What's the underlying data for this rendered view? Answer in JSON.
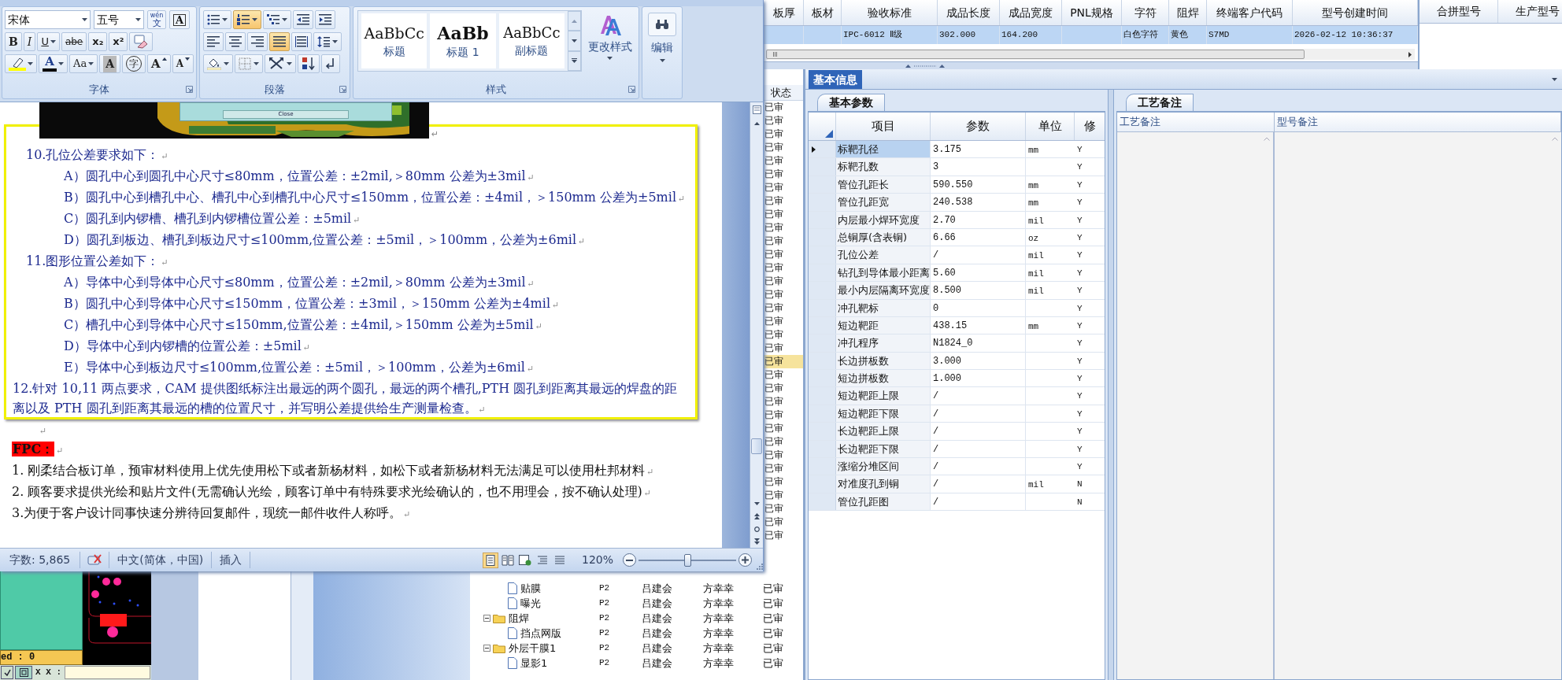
{
  "word": {
    "ribbon": {
      "font_name": "宋体",
      "font_size": "五号",
      "phonetic": {
        "ruby": "wén",
        "char": "文"
      },
      "char_border": "A",
      "font_tools": [
        {
          "kind": "bold",
          "label": "B"
        },
        {
          "kind": "italic",
          "label": "I"
        },
        {
          "kind": "underline",
          "label": "U",
          "dropdown": true
        },
        {
          "kind": "strike",
          "label": "abe"
        },
        {
          "kind": "subscript",
          "label": "x₂"
        },
        {
          "kind": "superscript",
          "label": "x²"
        },
        {
          "kind": "clear"
        }
      ],
      "font_tools_2": [
        {
          "kind": "highlight",
          "dropdown": true
        },
        {
          "kind": "color",
          "label": "A",
          "dropdown": true
        },
        {
          "kind": "case",
          "label": "Aa",
          "dropdown": true
        },
        {
          "kind": "shade",
          "label": "A"
        },
        {
          "kind": "enclose",
          "label": "字"
        },
        {
          "kind": "grow",
          "label": "A"
        },
        {
          "kind": "shrink",
          "label": "A"
        }
      ],
      "para_tools": [
        [
          {
            "kind": "bullets",
            "dropdown": true,
            "selected": false
          },
          {
            "kind": "numbering",
            "dropdown": true,
            "selected": true
          },
          {
            "kind": "multilevel",
            "dropdown": true,
            "selected": false
          },
          {
            "kind": "outdent",
            "selected": false
          },
          {
            "kind": "indent",
            "selected": false
          }
        ],
        [
          {
            "kind": "align-left",
            "selected": false
          },
          {
            "kind": "align-center",
            "selected": false
          },
          {
            "kind": "align-right",
            "selected": false
          },
          {
            "kind": "justify",
            "selected": true
          },
          {
            "kind": "distribute",
            "selected": false
          },
          {
            "kind": "line-spacing",
            "dropdown": true,
            "selected": false
          }
        ],
        [
          {
            "kind": "shading",
            "dropdown": true,
            "selected": false
          },
          {
            "kind": "borders",
            "dropdown": true,
            "selected": false
          },
          {
            "kind": "direction",
            "dropdown": true,
            "selected": false
          },
          {
            "kind": "sort",
            "selected": false
          },
          {
            "kind": "marks",
            "selected": false
          }
        ]
      ],
      "styles": [
        {
          "sample": "AaBbCc",
          "name": "标题",
          "kind": "title"
        },
        {
          "sample": "AaBb",
          "name": "标题 1",
          "kind": "heading"
        },
        {
          "sample": "AaBbCc",
          "name": "副标题",
          "kind": "subtitle"
        }
      ],
      "change_styles": "更改样式",
      "editing": "编辑",
      "groups": [
        "字体",
        "段落",
        "样式"
      ]
    },
    "document": {
      "picture_button": "Close",
      "picture_mark": "↵",
      "box": [
        {
          "text": "10.孔位公差要求如下：",
          "mark": "↵",
          "children": [
            {
              "text": "A）圆孔中心到圆孔中心尺寸≤80mm，位置公差：±2mil,＞80mm 公差为±3mil",
              "mark": "↵"
            },
            {
              "text": "B）圆孔中心到槽孔中心、槽孔中心到槽孔中心尺寸≤150mm，位置公差：±4mil，＞150mm 公差为±5mil",
              "mark": "↵"
            },
            {
              "text": "C）圆孔到内锣槽、槽孔到内锣槽位置公差：±5mil",
              "mark": "↵"
            },
            {
              "text": "D）圆孔到板边、槽孔到板边尺寸≤100mm,位置公差：±5mil，＞100mm，公差为±6mil",
              "mark": "↵"
            }
          ]
        },
        {
          "text": "11.图形位置公差如下：",
          "mark": "↵",
          "children": [
            {
              "text": "A）导体中心到导体中心尺寸≤80mm，位置公差：±2mil,＞80mm 公差为±3mil",
              "mark": "↵"
            },
            {
              "text": "B）圆孔中心到导体中心尺寸≤150mm，位置公差：±3mil，＞150mm 公差为±4mil",
              "mark": "↵"
            },
            {
              "text": "C）槽孔中心到导体中心尺寸≤150mm,位置公差：±4mil,＞150mm 公差为±5mil",
              "mark": "↵"
            },
            {
              "text": "D）导体中心到内锣槽的位置公差：±5mil",
              "mark": "↵"
            },
            {
              "text": "E）导体中心到板边尺寸≤100mm,位置公差：±5mil，＞100mm，公差为±6mil",
              "mark": "↵"
            }
          ]
        },
        {
          "text": "12.针对 10,11 两点要求，CAM 提供图纸标注出最远的两个圆孔，最远的两个槽孔,PTH 圆孔到距离其最远的焊盘的距离以及 PTH 圆孔到距离其最远的槽的位置尺寸，并写明公差提供给生产测量检查。",
          "mark": "↵"
        }
      ],
      "after": [
        {
          "kind": "blank",
          "mark": "↵"
        },
        {
          "kind": "highlight",
          "text": "FPC：",
          "mark": "↵"
        },
        {
          "kind": "plain",
          "text": "1.  刚柔结合板订单，预审材料使用上优先使用松下或者新杨材料，如松下或者新杨材料无法满足可以使用杜邦材料",
          "mark": "↵"
        },
        {
          "kind": "plain",
          "text": "2.  顾客要求提供光绘和贴片文件(无需确认光绘，顾客订单中有特殊要求光绘确认的，也不用理会，按不确认处理)",
          "mark": "↵"
        },
        {
          "kind": "plain",
          "text": "3.为便于客户设计同事快速分辨待回复邮件，现统一邮件收件人称呼。",
          "mark": "↵"
        }
      ]
    },
    "status_bar": {
      "word_count": "字数: 5,865",
      "language": "中文(简体，中国)",
      "mode": "插入",
      "zoom": "120%",
      "zoom_slider": {
        "level": 0.5
      },
      "views": [
        {
          "kind": "print",
          "selected": true
        },
        {
          "kind": "reading",
          "selected": false
        },
        {
          "kind": "web",
          "selected": false
        },
        {
          "kind": "outline",
          "selected": false
        },
        {
          "kind": "draft",
          "selected": false
        }
      ]
    }
  },
  "grid": {
    "columns": [
      "板厚",
      "板材",
      "验收标准",
      "成品长度",
      "成品宽度",
      "PNL规格",
      "字符",
      "阻焊",
      "终端客户代码",
      "型号创建时间"
    ],
    "rows": [
      {
        "selected": true,
        "cells": [
          null,
          null,
          "IPC-6012 Ⅱ级",
          "302.000",
          "164.200",
          null,
          "白色字符",
          "黄色",
          "S7MD",
          "2026-02-12 10:36:37"
        ]
      }
    ]
  },
  "merge_box": {
    "columns": [
      "合拼型号",
      "生产型号"
    ]
  },
  "status_column": {
    "header": "状态",
    "cells": [
      {
        "text": "已审",
        "selected": false
      },
      {
        "text": "已审",
        "selected": false
      },
      {
        "text": "已审",
        "selected": false
      },
      {
        "text": "已审",
        "selected": false
      },
      {
        "text": "已审",
        "selected": false
      },
      {
        "text": "已审",
        "selected": false
      },
      {
        "text": "已审",
        "selected": false
      },
      {
        "text": "已审",
        "selected": false
      },
      {
        "text": "已审",
        "selected": false
      },
      {
        "text": "已审",
        "selected": false
      },
      {
        "text": "已审",
        "selected": false
      },
      {
        "text": "已审",
        "selected": false
      },
      {
        "text": "已审",
        "selected": false
      },
      {
        "text": "已审",
        "selected": false
      },
      {
        "text": "已审",
        "selected": false
      },
      {
        "text": "已审",
        "selected": false
      },
      {
        "text": "已审",
        "selected": false
      },
      {
        "text": "已审",
        "selected": false
      },
      {
        "text": "已审",
        "selected": false
      },
      {
        "text": "已审",
        "selected": true
      },
      {
        "text": "已审",
        "selected": false
      },
      {
        "text": "已审",
        "selected": false
      },
      {
        "text": "已审",
        "selected": false
      },
      {
        "text": "已审",
        "selected": false
      },
      {
        "text": "已审",
        "selected": false
      },
      {
        "text": "已审",
        "selected": false
      },
      {
        "text": "已审",
        "selected": false
      },
      {
        "text": "已审",
        "selected": false
      },
      {
        "text": "已审",
        "selected": false
      },
      {
        "text": "已审",
        "selected": false
      },
      {
        "text": "已审",
        "selected": false
      },
      {
        "text": "已审",
        "selected": false
      },
      {
        "text": "已审",
        "selected": false
      }
    ]
  },
  "tree": [
    {
      "children": [
        {
          "label": "贴膜",
          "kind": "file",
          "version": "P2",
          "maker": "吕建会",
          "checker": "方幸幸",
          "status": "已审"
        },
        {
          "label": "曝光",
          "kind": "file",
          "version": "P2",
          "maker": "吕建会",
          "checker": "方幸幸",
          "status": "已审"
        }
      ]
    },
    {
      "label": "阻焊",
      "kind": "folder",
      "expanded": true,
      "version": "P2",
      "maker": "吕建会",
      "checker": "方幸幸",
      "status": "已审",
      "children": [
        {
          "label": "挡点网版",
          "kind": "file",
          "version": "P2",
          "maker": "吕建会",
          "checker": "方幸幸",
          "status": "已审"
        }
      ]
    },
    {
      "label": "外层干膜1",
      "kind": "folder",
      "expanded": true,
      "version": "P2",
      "maker": "吕建会",
      "checker": "方幸幸",
      "status": "已审",
      "children": [
        {
          "label": "显影1",
          "kind": "file",
          "version": "P2",
          "maker": "吕建会",
          "checker": "方幸幸",
          "status": "已审"
        }
      ]
    }
  ],
  "pcb_viewer": {
    "counter": "ed : 0",
    "coord_label": "X X :"
  },
  "info_panel": {
    "tabs": [
      {
        "label": "基本信息",
        "selected": true
      }
    ],
    "params": {
      "tab": "基本参数",
      "columns": [
        "项目",
        "参数",
        "单位",
        "修"
      ],
      "rows": [
        {
          "item": "标靶孔径",
          "value": "3.175",
          "unit": "mm",
          "mod": "Y",
          "selected": true
        },
        {
          "item": "标靶孔数",
          "value": "3",
          "mod": "Y",
          "selected": false
        },
        {
          "item": "管位孔距长",
          "value": "590.550",
          "unit": "mm",
          "mod": "Y",
          "selected": false
        },
        {
          "item": "管位孔距宽",
          "value": "240.538",
          "unit": "mm",
          "mod": "Y",
          "selected": false
        },
        {
          "item": "内层最小焊环宽度",
          "value": "2.70",
          "unit": "mil",
          "mod": "Y",
          "selected": false
        },
        {
          "item": "总铜厚(含表铜)",
          "value": "6.66",
          "unit": "oz",
          "mod": "Y",
          "selected": false
        },
        {
          "item": "孔位公差",
          "value": "/",
          "unit": "mil",
          "mod": "Y",
          "selected": false
        },
        {
          "item": "钻孔到导体最小距离",
          "value": "5.60",
          "unit": "mil",
          "mod": "Y",
          "selected": false
        },
        {
          "item": "最小内层隔离环宽度",
          "value": "8.500",
          "unit": "mil",
          "mod": "Y",
          "selected": false
        },
        {
          "item": "冲孔靶标",
          "value": "0",
          "mod": "Y",
          "selected": false
        },
        {
          "item": "短边靶距",
          "value": "438.15",
          "unit": "mm",
          "mod": "Y",
          "selected": false
        },
        {
          "item": "冲孔程序",
          "value": "N1824_0",
          "mod": "Y",
          "selected": false
        },
        {
          "item": "长边拼板数",
          "value": "3.000",
          "mod": "Y",
          "selected": false
        },
        {
          "item": "短边拼板数",
          "value": "1.000",
          "mod": "Y",
          "selected": false
        },
        {
          "item": "短边靶距上限",
          "value": "/",
          "mod": "Y",
          "selected": false
        },
        {
          "item": "短边靶距下限",
          "value": "/",
          "mod": "Y",
          "selected": false
        },
        {
          "item": "长边靶距上限",
          "value": "/",
          "mod": "Y",
          "selected": false
        },
        {
          "item": "长边靶距下限",
          "value": "/",
          "mod": "Y",
          "selected": false
        },
        {
          "item": "涨缩分堆区间",
          "value": "/",
          "mod": "Y",
          "selected": false
        },
        {
          "item": "对准度孔到铜",
          "value": "/",
          "unit": "mil",
          "mod": "N",
          "selected": false
        },
        {
          "item": "管位孔距图",
          "value": "/",
          "mod": "N",
          "selected": false
        }
      ]
    },
    "notes": {
      "tab": "工艺备注",
      "columns": [
        "工艺备注",
        "型号备注"
      ]
    }
  }
}
